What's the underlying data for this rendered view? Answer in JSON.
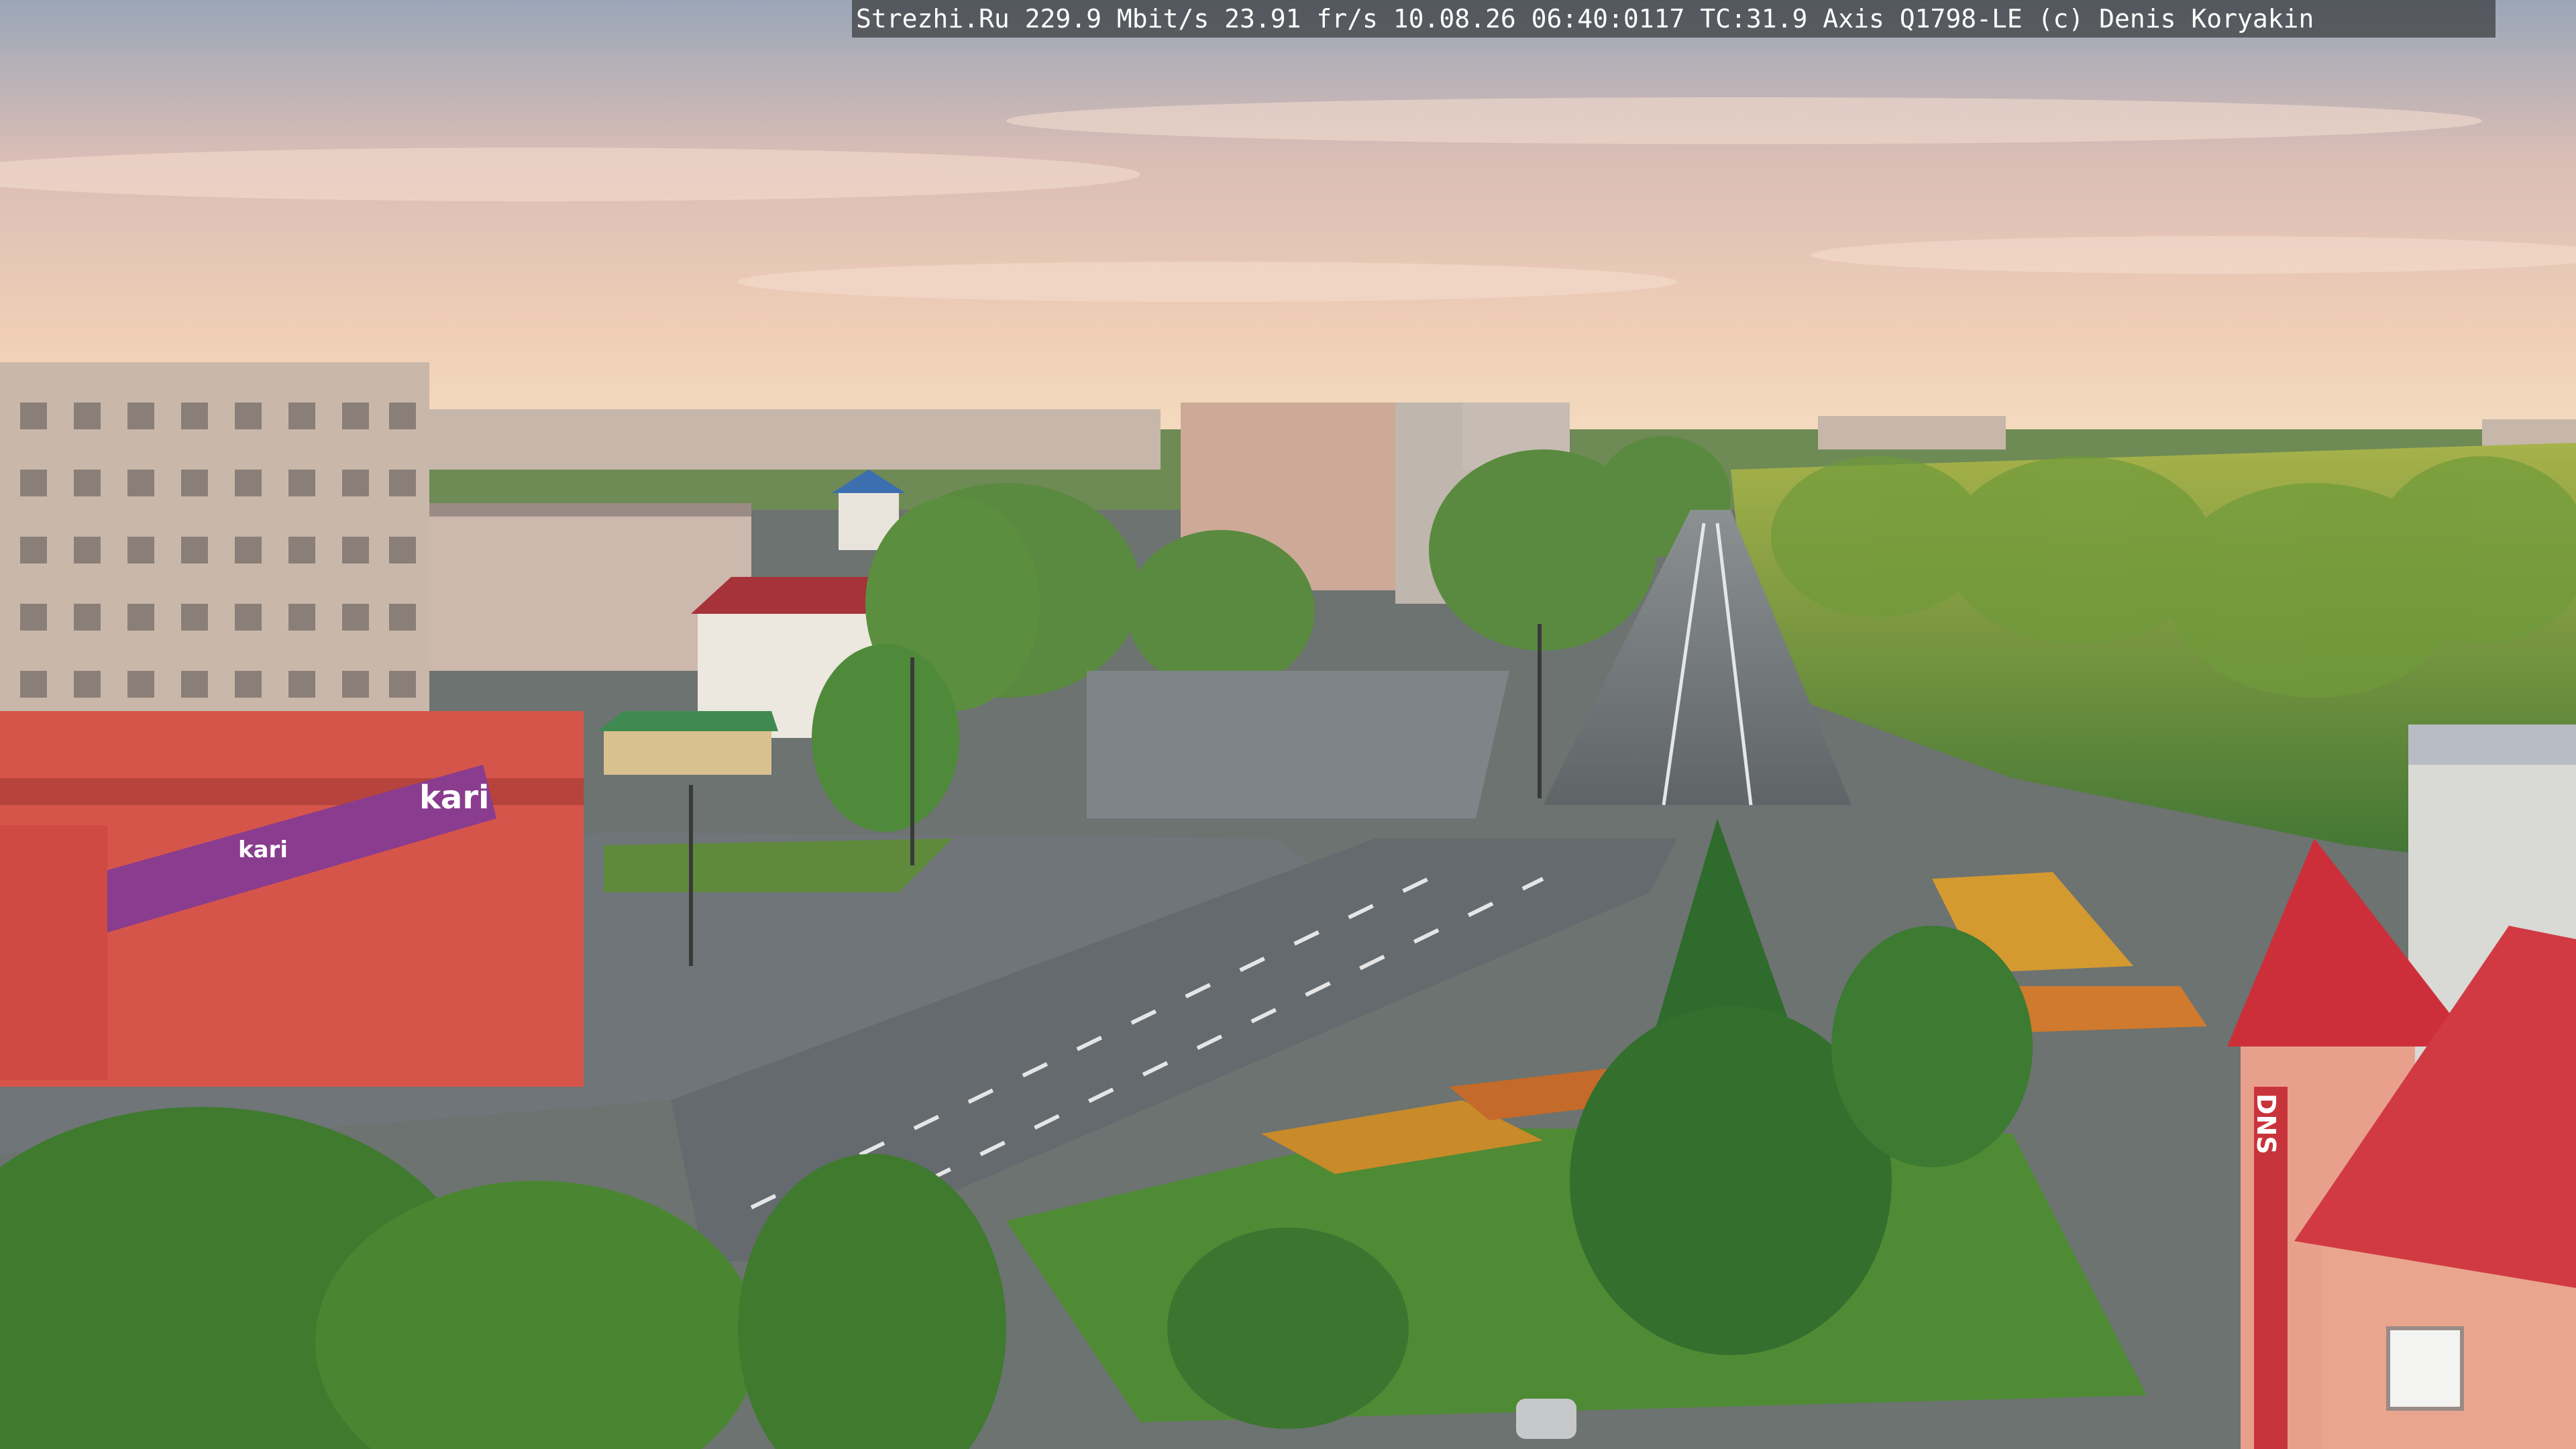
{
  "overlay": {
    "text": "Strezhi.Ru 229.9 Mbit/s 23.91 fr/s 10.08.26 06:40:0117 TC:31.9  Axis Q1798-LE  (c) Denis Koryakin"
  },
  "signs": {
    "store_brand": "kari",
    "store_brand_small": "kari",
    "tower_sign": "DNS"
  },
  "colors": {
    "sky_top": "#9fa9b8",
    "sky_mid": "#e7c7b5",
    "sky_horizon": "#f3d6b8",
    "road": "#6f7679",
    "plaza": "#7b8184",
    "trees": "#4f8a3e",
    "roof_red": "#c8343c",
    "store_red": "#d9534a",
    "banner_purple": "#8a3c8e"
  }
}
